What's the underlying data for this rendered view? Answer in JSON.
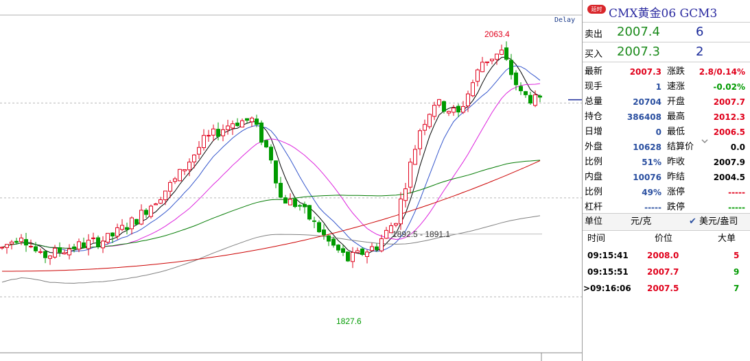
{
  "chart": {
    "delay_label": "Delay",
    "annotations": {
      "high": "2063.4",
      "low": "1827.6",
      "range": "1892.5 - 1891.1"
    },
    "colors": {
      "up": "#e0001b",
      "down": "#009a00",
      "ma5": "#000000",
      "ma10": "#3355cc",
      "ma20": "#dd22dd",
      "ma60": "#007a00",
      "ma120": "#808080",
      "ma250": "#cc0000"
    }
  },
  "chart_data": {
    "type": "candlestick",
    "title": "",
    "ylim": [
      1790,
      2080
    ],
    "price_labels": {
      "high": 2063.4,
      "low": 1827.6,
      "range_a": 1892.5,
      "range_b": 1891.1
    },
    "current_price": 2007.3
  },
  "panel": {
    "badge": "延时",
    "title": "CMX黄金06  GCM3",
    "ask": {
      "label": "卖出",
      "price": "2007.4",
      "volume": "6"
    },
    "bid": {
      "label": "买入",
      "price": "2007.3",
      "volume": "2"
    },
    "left_stats": [
      {
        "k": "最新",
        "v": "2007.3",
        "c": "red"
      },
      {
        "k": "现手",
        "v": "1",
        "c": "blue"
      },
      {
        "k": "总量",
        "v": "20704",
        "c": "blue"
      },
      {
        "k": "持仓",
        "v": "386408",
        "c": "blue"
      },
      {
        "k": "日增",
        "v": "0",
        "c": "blue"
      },
      {
        "k": "外盘",
        "v": "10628",
        "c": "blue"
      },
      {
        "k": "比例",
        "v": "51%",
        "c": "blue"
      },
      {
        "k": "内盘",
        "v": "10076",
        "c": "blue"
      },
      {
        "k": "比例",
        "v": "49%",
        "c": "blue"
      },
      {
        "k": "杠杆",
        "v": "-----",
        "c": "blue"
      }
    ],
    "right_stats": [
      {
        "k": "涨跌",
        "v": "2.8/0.14%",
        "c": "red"
      },
      {
        "k": "速涨",
        "v": "-0.02%",
        "c": "green"
      },
      {
        "k": "开盘",
        "v": "2007.7",
        "c": "red"
      },
      {
        "k": "最高",
        "v": "2012.3",
        "c": "red"
      },
      {
        "k": "最低",
        "v": "2006.5",
        "c": "red"
      },
      {
        "k": "结算价",
        "v": "0.0",
        "c": "black"
      },
      {
        "k": "昨收",
        "v": "2007.9",
        "c": "black"
      },
      {
        "k": "昨结",
        "v": "2004.5",
        "c": "black"
      },
      {
        "k": "涨停",
        "v": "-----",
        "c": "red"
      },
      {
        "k": "跌停",
        "v": "-----",
        "c": "green"
      }
    ],
    "unit": {
      "label": "单位",
      "value": "元/克",
      "alt": "美元/盎司"
    },
    "ticks_header": {
      "time": "时间",
      "price": "价位",
      "size": "大单"
    },
    "ticks": [
      {
        "time": "09:15:41",
        "price": "2008.0",
        "size": "5",
        "size_color": "red"
      },
      {
        "time": "09:15:51",
        "price": "2007.7",
        "size": "9",
        "size_color": "green"
      },
      {
        "time": "09:16:06",
        "price": "2007.5",
        "size": "7",
        "size_color": "green",
        "marker": ">"
      }
    ]
  }
}
